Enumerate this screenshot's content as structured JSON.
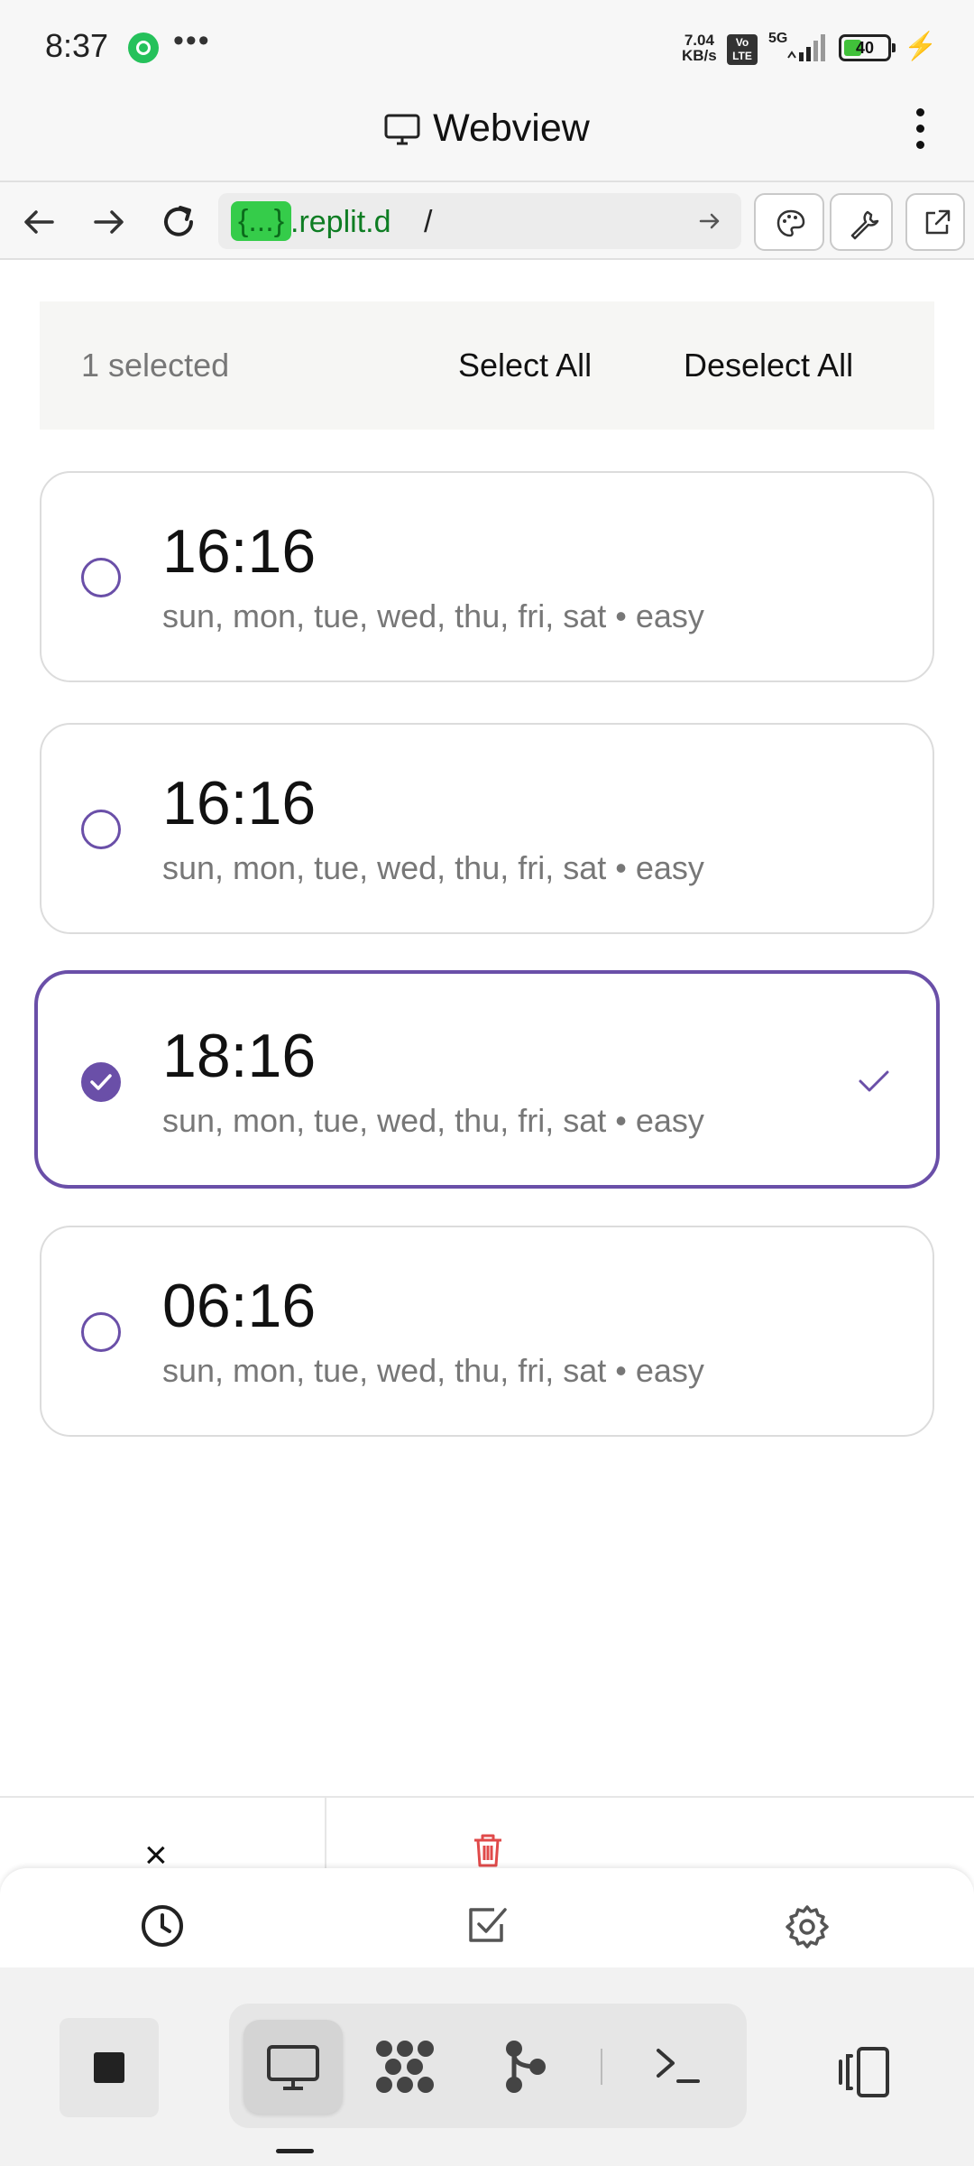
{
  "status_bar": {
    "time": "8:37",
    "overflow": "•••",
    "net_speed_value": "7.04",
    "net_speed_unit": "KB/s",
    "volte_line1": "Vo",
    "volte_line2": "LTE",
    "network": "5G",
    "battery_level": "40",
    "icons": [
      "whatsapp-icon",
      "volte-icon",
      "signal-icon",
      "battery-icon",
      "charging-icon"
    ]
  },
  "titlebar": {
    "title": "Webview",
    "icon": "monitor-icon"
  },
  "urlbar": {
    "host_tag": "{...}",
    "host": ".replit.d",
    "path": "/",
    "icons": [
      "back-arrow-icon",
      "forward-arrow-icon",
      "reload-icon",
      "go-arrow-icon",
      "palette-icon",
      "wrench-icon",
      "open-external-icon"
    ]
  },
  "selection": {
    "count_text": "1 selected",
    "select_all": "Select All",
    "deselect_all": "Deselect All"
  },
  "alarms": [
    {
      "time": "16:16",
      "details": "sun, mon, tue, wed, thu, fri, sat • easy",
      "selected": false
    },
    {
      "time": "16:16",
      "details": "sun, mon, tue, wed, thu, fri, sat • easy",
      "selected": false
    },
    {
      "time": "18:16",
      "details": "sun, mon, tue, wed, thu, fri, sat • easy",
      "selected": true
    },
    {
      "time": "06:16",
      "details": "sun, mon, tue, wed, thu, fri, sat • easy",
      "selected": false
    }
  ],
  "action_bar": {
    "cancel_glyph": "×",
    "delete_icon": "trash-icon"
  },
  "tabs": [
    {
      "icon": "clock-icon",
      "label": ""
    },
    {
      "icon": "checkbox-icon",
      "label": ""
    },
    {
      "icon": "gear-icon",
      "label": ""
    }
  ],
  "replit_bar": {
    "icons": [
      "stop-icon",
      "monitor-icon",
      "dots-grid-icon",
      "git-branch-icon",
      "terminal-icon",
      "devices-icon"
    ]
  },
  "colors": {
    "accent": "#6a4fa8",
    "url_tag_bg": "#35cc4a",
    "url_text": "#0e7d23",
    "delete": "#e04a4a"
  }
}
